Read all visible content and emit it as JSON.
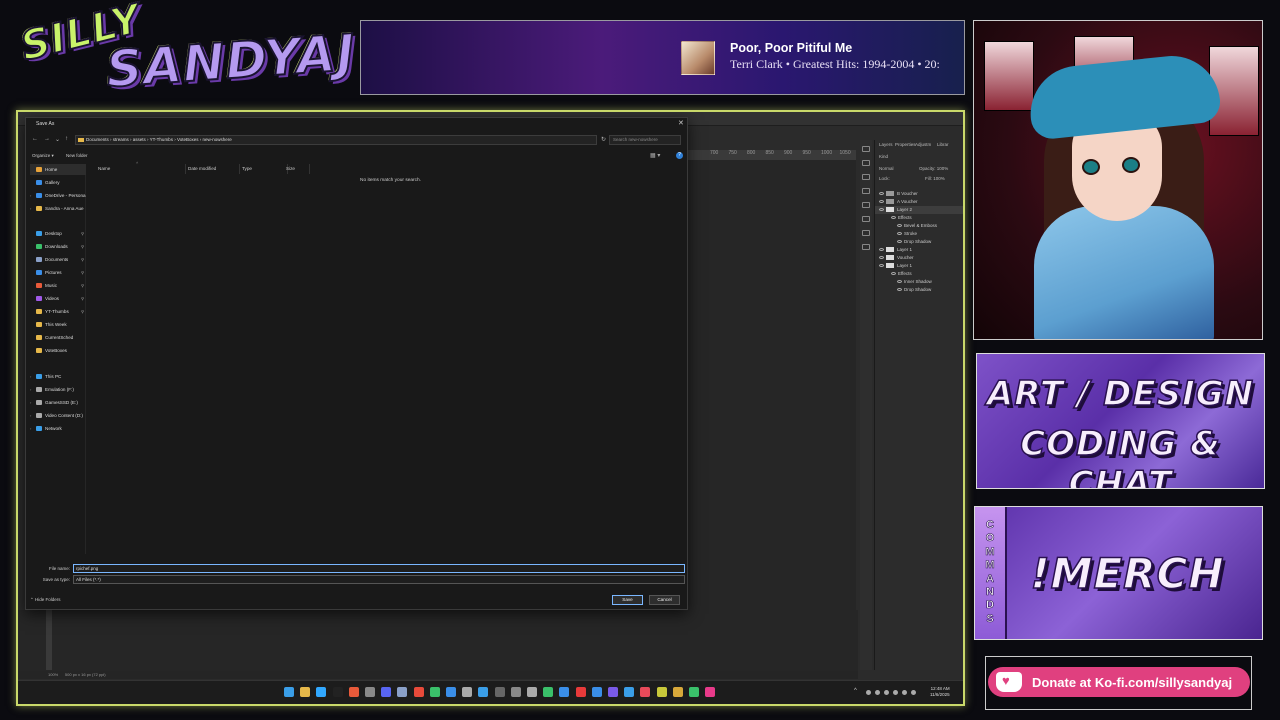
{
  "overlay": {
    "logo": {
      "line1": "SILLY",
      "line2": "SANDYAJ"
    },
    "now_playing": {
      "title": "Poor, Poor Pitiful Me",
      "meta": "Terri Clark • Greatest Hits: 1994-2004 • 20:"
    },
    "panels": {
      "art_line1": "ART / DESIGN",
      "art_line2": "CODING & CHAT",
      "commands_letters": [
        "C",
        "O",
        "M",
        "M",
        "A",
        "N",
        "D",
        "S"
      ],
      "merch": "!MERCH"
    },
    "kofi": "Donate at Ko-fi.com/sillysandyaj",
    "colors": {
      "frame_accent": "#c9d96a",
      "kofi": "#e0407f",
      "panel_purple": "#7e52c8"
    }
  },
  "dialog": {
    "title": "Save As",
    "close_glyph": "✕",
    "nav": {
      "back": "←",
      "forward": "→",
      "down": "⌄",
      "up": "↑"
    },
    "address": [
      "Documents",
      "›",
      "streams",
      "›",
      "assets",
      "›",
      "YT-Thumbs",
      "›",
      "VoteBoxes",
      "›",
      "new-nowshere"
    ],
    "address_text": "Documents  ›  streams  ›  assets  ›  YT-Thumbs  ›  VoteBoxes  ›  new-nowshere",
    "search_placeholder": "Search new-nowshere",
    "commands": {
      "organize": "Organize ▾",
      "new_folder": "New folder"
    },
    "nav_pane": [
      {
        "label": "Home",
        "icon": "home-icon",
        "color": "#e8a33a",
        "selected": true
      },
      {
        "label": "Gallery",
        "icon": "gallery-icon",
        "color": "#3a8ee8"
      },
      {
        "label": "OneDrive - Persona",
        "icon": "cloud-icon",
        "color": "#3a8ee8",
        "chevron": true
      },
      {
        "label": "Sandra - Anna Aue",
        "icon": "folder-icon",
        "color": "#e6b84a",
        "chevron": true
      },
      {
        "label": "Desktop",
        "icon": "desktop-icon",
        "color": "#3a9ee8",
        "pinned": true
      },
      {
        "label": "Downloads",
        "icon": "download-icon",
        "color": "#3ac06a",
        "pinned": true
      },
      {
        "label": "Documents",
        "icon": "documents-icon",
        "color": "#8aa0c8",
        "pinned": true
      },
      {
        "label": "Pictures",
        "icon": "pictures-icon",
        "color": "#3a8ee8",
        "pinned": true
      },
      {
        "label": "Music",
        "icon": "music-icon",
        "color": "#e85a3a",
        "pinned": true
      },
      {
        "label": "Videos",
        "icon": "videos-icon",
        "color": "#a05ae8",
        "pinned": true
      },
      {
        "label": "YT-Thumbs",
        "icon": "folder-icon",
        "color": "#e6b84a",
        "pinned": true
      },
      {
        "label": "This Week",
        "icon": "folder-icon",
        "color": "#e6b84a"
      },
      {
        "label": "CurrentSched",
        "icon": "folder-icon",
        "color": "#e6b84a"
      },
      {
        "label": "VoteBoxes",
        "icon": "folder-icon",
        "color": "#e6b84a"
      },
      {
        "label": "This PC",
        "icon": "pc-icon",
        "color": "#3a9ee8",
        "chevron": true
      },
      {
        "label": "Emulation (F:)",
        "icon": "drive-icon",
        "color": "#aaaaaa",
        "chevron": true
      },
      {
        "label": "GamesSSD (E:)",
        "icon": "drive-icon",
        "color": "#aaaaaa",
        "chevron": true
      },
      {
        "label": "Video Content (D:)",
        "icon": "drive-icon",
        "color": "#aaaaaa",
        "chevron": true
      },
      {
        "label": "Network",
        "icon": "network-icon",
        "color": "#3a9ee8",
        "chevron": true
      }
    ],
    "columns": [
      "Name",
      "Date modified",
      "Type",
      "Size"
    ],
    "empty_message": "No items match your search.",
    "file_name_label": "File name:",
    "file_name_value": "rpichef.png",
    "save_type_label": "Save as type:",
    "save_type_value": "All Files (*.*)",
    "hide_folders": "Hide Folders",
    "save_button": "Save",
    "cancel_button": "Cancel"
  },
  "photoshop": {
    "ruler_ticks": [
      "700",
      "750",
      "800",
      "850",
      "900",
      "950",
      "1000",
      "1050"
    ],
    "panel_tabs": [
      "Layers",
      "Properties",
      "Adjustm",
      "Librar"
    ],
    "blend_mode": "Normal",
    "opacity": "Opacity: 100%",
    "fill": "Fill: 100%",
    "lock": "Lock:",
    "kind": "Kind",
    "layers": [
      {
        "name": "B Voucher",
        "type": "group"
      },
      {
        "name": "A Voucher",
        "type": "group"
      },
      {
        "name": "Layer 2",
        "type": "layer",
        "selected": true,
        "fx": true
      },
      {
        "name": "Effects",
        "type": "effects"
      },
      {
        "name": "Bevel & Emboss",
        "type": "effect"
      },
      {
        "name": "Stroke",
        "type": "effect"
      },
      {
        "name": "Drop Shadow",
        "type": "effect"
      },
      {
        "name": "Layer 1",
        "type": "layer"
      },
      {
        "name": "Voucher",
        "type": "text"
      },
      {
        "name": "Layer 1",
        "type": "layer",
        "fx": true
      },
      {
        "name": "Effects",
        "type": "effects"
      },
      {
        "name": "Inner Shadow",
        "type": "effect"
      },
      {
        "name": "Drop Shadow",
        "type": "effect"
      }
    ],
    "zoom": "100%",
    "doc_size": "500 px x 16 px (72 ppi)"
  },
  "taskbar": {
    "time": "12:48 AM",
    "date": "11/6/2025",
    "tray_up": "^"
  }
}
